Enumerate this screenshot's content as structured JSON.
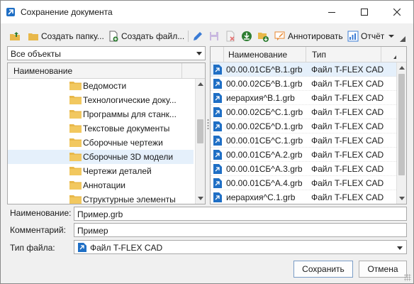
{
  "window": {
    "title": "Сохранение документа",
    "minimize_glyph": "—",
    "maximize_glyph": "☐",
    "close_glyph": "✕"
  },
  "toolbar": {
    "create_folder_label": "Создать папку...",
    "create_file_label": "Создать файл...",
    "annotate_label": "Аннотировать",
    "report_label": "Отчёт",
    "icons": [
      "up-folder-icon",
      "new-folder-icon",
      "new-file-icon",
      "pencil-icon",
      "save-icon",
      "delete-file-icon",
      "download-icon",
      "folder-download-icon",
      "annotate-icon",
      "report-icon"
    ]
  },
  "left_pane": {
    "filter_value": "Все объекты",
    "column_header": "Наименование",
    "items": [
      {
        "label": "Ведомости"
      },
      {
        "label": "Технологические доку..."
      },
      {
        "label": "Программы для станк..."
      },
      {
        "label": "Текстовые документы"
      },
      {
        "label": "Сборочные чертежи"
      },
      {
        "label": "Сборочные 3D модели",
        "selected": true
      },
      {
        "label": "Чертежи деталей"
      },
      {
        "label": "Аннотации"
      },
      {
        "label": "Структурные элементы"
      }
    ]
  },
  "file_list": {
    "columns": [
      "Наименование",
      "Тип"
    ],
    "rows": [
      {
        "name": "00.00.01СБ^B.1.grb",
        "type": "Файл T-FLEX CAD",
        "selected": true
      },
      {
        "name": "00.00.02СБ^B.1.grb",
        "type": "Файл T-FLEX CAD"
      },
      {
        "name": "иерархия^B.1.grb",
        "type": "Файл T-FLEX CAD"
      },
      {
        "name": "00.00.02СБ^C.1.grb",
        "type": "Файл T-FLEX CAD"
      },
      {
        "name": "00.00.02СБ^D.1.grb",
        "type": "Файл T-FLEX CAD"
      },
      {
        "name": "00.00.01СБ^C.1.grb",
        "type": "Файл T-FLEX CAD"
      },
      {
        "name": "00.00.01СБ^A.2.grb",
        "type": "Файл T-FLEX CAD"
      },
      {
        "name": "00.00.01СБ^A.3.grb",
        "type": "Файл T-FLEX CAD"
      },
      {
        "name": "00.00.01СБ^A.4.grb",
        "type": "Файл T-FLEX CAD"
      },
      {
        "name": "иерархия^C.1.grb",
        "type": "Файл T-FLEX CAD"
      }
    ]
  },
  "form": {
    "name_label": "Наименование:",
    "name_value": "Пример.grb",
    "comment_label": "Комментарий:",
    "comment_value": "Пример",
    "filetype_label": "Тип файла:",
    "filetype_value": "Файл T-FLEX CAD"
  },
  "buttons": {
    "save_label": "Сохранить",
    "cancel_label": "Отмена"
  },
  "colors": {
    "selection": "#e5f0fb",
    "tflex_blue": "#1f6fc5",
    "folder": "#e8b84a"
  }
}
